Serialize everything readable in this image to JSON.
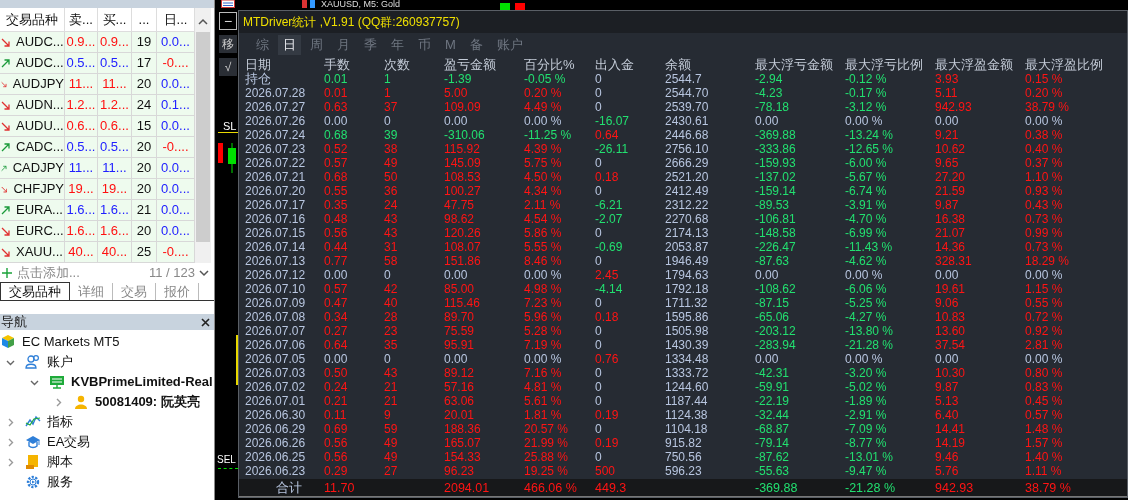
{
  "market_watch": {
    "columns": [
      "交易品种",
      "卖...",
      "买...",
      "...",
      "日..."
    ],
    "rows": [
      {
        "rising": false,
        "daily_down": false,
        "cells": [
          "AUDC...",
          "0.9...",
          "0.9...",
          "19",
          "0.0..."
        ]
      },
      {
        "rising": true,
        "daily_down": true,
        "cells": [
          "AUDC...",
          "0.5...",
          "0.5...",
          "17",
          "-0...."
        ]
      },
      {
        "rising": false,
        "daily_down": false,
        "cells": [
          "AUDJPY",
          "11...",
          "11...",
          "20",
          "0.0..."
        ]
      },
      {
        "rising": false,
        "daily_down": false,
        "cells": [
          "AUDN...",
          "1.2...",
          "1.2...",
          "24",
          "0.1..."
        ]
      },
      {
        "rising": false,
        "daily_down": false,
        "cells": [
          "AUDU...",
          "0.6...",
          "0.6...",
          "15",
          "0.0..."
        ]
      },
      {
        "rising": true,
        "daily_down": true,
        "cells": [
          "CADC...",
          "0.5...",
          "0.5...",
          "20",
          "-0...."
        ]
      },
      {
        "rising": true,
        "daily_down": false,
        "cells": [
          "CADJPY",
          "11...",
          "11...",
          "20",
          "0.0..."
        ]
      },
      {
        "rising": false,
        "daily_down": false,
        "cells": [
          "CHFJPY",
          "19...",
          "19...",
          "20",
          "0.0..."
        ]
      },
      {
        "rising": true,
        "daily_down": false,
        "cells": [
          "EURA...",
          "1.6...",
          "1.6...",
          "21",
          "0.0..."
        ]
      },
      {
        "rising": false,
        "daily_down": false,
        "cells": [
          "EURC...",
          "1.6...",
          "1.6...",
          "20",
          "0.0..."
        ]
      },
      {
        "rising": false,
        "daily_down": true,
        "cells": [
          "XAUU...",
          "40...",
          "40...",
          "25",
          "-0...."
        ]
      }
    ],
    "add_label": "点击添加...",
    "count": "11 / 123",
    "tabs": [
      {
        "label": "交易品种",
        "selected": true
      },
      {
        "label": "详细",
        "selected": false
      },
      {
        "label": "交易",
        "selected": false
      },
      {
        "label": "报价",
        "selected": false
      }
    ]
  },
  "navigator": {
    "title": "导航",
    "items": [
      {
        "label": "EC Markets MT5",
        "kind": "broker",
        "children": [
          {
            "label": "账户",
            "kind": "accounts",
            "expanded": true,
            "children": [
              {
                "label": "KVBPrimeLimited-Real",
                "kind": "server",
                "expanded": true,
                "children": [
                  {
                    "label": "50081409: 阮英亮",
                    "kind": "account",
                    "expanded": false
                  }
                ]
              }
            ]
          },
          {
            "label": "指标",
            "kind": "indicators",
            "expanded": false
          },
          {
            "label": "EA交易",
            "kind": "experts",
            "expanded": false
          },
          {
            "label": "脚本",
            "kind": "scripts",
            "expanded": false
          },
          {
            "label": "服务",
            "kind": "services"
          }
        ]
      }
    ]
  },
  "chart": {
    "title": "XAUUSD, M5: Gold",
    "toolbar": [
      {
        "kind": "minus",
        "label": "−"
      },
      {
        "kind": "text",
        "label": "移"
      },
      {
        "kind": "text",
        "label": "√"
      }
    ],
    "sl_label": "SL",
    "sell_label": "SEL"
  },
  "stats_panel": {
    "title": "MTDriver统计 ,V1.91 (QQ群:260937757)",
    "tabs": [
      {
        "label": "综",
        "selected": false
      },
      {
        "label": "日",
        "selected": true
      },
      {
        "label": "周",
        "selected": false
      },
      {
        "label": "月",
        "selected": false
      },
      {
        "label": "季",
        "selected": false
      },
      {
        "label": "年",
        "selected": false
      },
      {
        "label": "币",
        "selected": false
      },
      {
        "label": "M",
        "selected": false
      },
      {
        "label": "备",
        "selected": false
      },
      {
        "label": "账户",
        "selected": false
      }
    ],
    "columns": [
      "日期",
      "手数",
      "次数",
      "盈亏金额",
      "百分比%",
      "出入金",
      "余额",
      "最大浮亏金额",
      "最大浮亏比例",
      "最大浮盈金额",
      "最大浮盈比例"
    ],
    "rows": [
      {
        "kind": "loss",
        "deposit": false,
        "withdrawal": false,
        "cells": [
          "持仓",
          "0.01",
          "1",
          "-1.39",
          "-0.05 %",
          "0",
          "2544.7",
          "-2.94",
          "-0.12 %",
          "3.93",
          "0.15 %"
        ]
      },
      {
        "kind": "profit",
        "deposit": false,
        "withdrawal": false,
        "cells": [
          "2026.07.28",
          "0.01",
          "1",
          "5.00",
          "0.20 %",
          "0",
          "2544.70",
          "-4.23",
          "-0.17 %",
          "5.11",
          "0.20 %"
        ]
      },
      {
        "kind": "profit",
        "deposit": false,
        "withdrawal": false,
        "cells": [
          "2026.07.27",
          "0.63",
          "37",
          "109.09",
          "4.49 %",
          "0",
          "2539.70",
          "-78.18",
          "-3.12 %",
          "942.93",
          "38.79 %"
        ]
      },
      {
        "kind": "flat",
        "deposit": false,
        "withdrawal": true,
        "cells": [
          "2026.07.26",
          "0.00",
          "0",
          "0.00",
          "0.00 %",
          "-16.07",
          "2430.61",
          "0.00",
          "0.00 %",
          "0.00",
          "0.00 %"
        ]
      },
      {
        "kind": "loss",
        "deposit": true,
        "withdrawal": false,
        "cells": [
          "2026.07.24",
          "0.68",
          "39",
          "-310.06",
          "-11.25 %",
          "0.64",
          "2446.68",
          "-369.88",
          "-13.24 %",
          "9.21",
          "0.38 %"
        ]
      },
      {
        "kind": "profit",
        "deposit": false,
        "withdrawal": true,
        "cells": [
          "2026.07.23",
          "0.52",
          "38",
          "115.92",
          "4.39 %",
          "-26.11",
          "2756.10",
          "-333.86",
          "-12.65 %",
          "10.62",
          "0.40 %"
        ]
      },
      {
        "kind": "profit",
        "deposit": false,
        "withdrawal": false,
        "cells": [
          "2026.07.22",
          "0.57",
          "49",
          "145.09",
          "5.75 %",
          "0",
          "2666.29",
          "-159.93",
          "-6.00 %",
          "9.65",
          "0.37 %"
        ]
      },
      {
        "kind": "profit",
        "deposit": true,
        "withdrawal": false,
        "cells": [
          "2026.07.21",
          "0.68",
          "50",
          "108.53",
          "4.50 %",
          "0.18",
          "2521.20",
          "-137.02",
          "-5.67 %",
          "27.20",
          "1.10 %"
        ]
      },
      {
        "kind": "profit",
        "deposit": false,
        "withdrawal": false,
        "cells": [
          "2026.07.20",
          "0.55",
          "36",
          "100.27",
          "4.34 %",
          "0",
          "2412.49",
          "-159.14",
          "-6.74 %",
          "21.59",
          "0.93 %"
        ]
      },
      {
        "kind": "profit",
        "deposit": false,
        "withdrawal": true,
        "cells": [
          "2026.07.17",
          "0.35",
          "24",
          "47.75",
          "2.11 %",
          "-6.21",
          "2312.22",
          "-89.53",
          "-3.91 %",
          "9.87",
          "0.43 %"
        ]
      },
      {
        "kind": "profit",
        "deposit": false,
        "withdrawal": true,
        "cells": [
          "2026.07.16",
          "0.48",
          "43",
          "98.62",
          "4.54 %",
          "-2.07",
          "2270.68",
          "-106.81",
          "-4.70 %",
          "16.38",
          "0.73 %"
        ]
      },
      {
        "kind": "profit",
        "deposit": false,
        "withdrawal": false,
        "cells": [
          "2026.07.15",
          "0.56",
          "43",
          "120.26",
          "5.86 %",
          "0",
          "2174.13",
          "-148.58",
          "-6.99 %",
          "21.07",
          "0.99 %"
        ]
      },
      {
        "kind": "profit",
        "deposit": false,
        "withdrawal": true,
        "cells": [
          "2026.07.14",
          "0.44",
          "31",
          "108.07",
          "5.55 %",
          "-0.69",
          "2053.87",
          "-226.47",
          "-11.43 %",
          "14.36",
          "0.73 %"
        ]
      },
      {
        "kind": "profit",
        "deposit": false,
        "withdrawal": false,
        "cells": [
          "2026.07.13",
          "0.77",
          "58",
          "151.86",
          "8.46 %",
          "0",
          "1946.49",
          "-87.63",
          "-4.62 %",
          "328.31",
          "18.29 %"
        ]
      },
      {
        "kind": "flat",
        "deposit": true,
        "withdrawal": false,
        "cells": [
          "2026.07.12",
          "0.00",
          "0",
          "0.00",
          "0.00 %",
          "2.45",
          "1794.63",
          "0.00",
          "0.00 %",
          "0.00",
          "0.00 %"
        ]
      },
      {
        "kind": "profit",
        "deposit": false,
        "withdrawal": true,
        "cells": [
          "2026.07.10",
          "0.57",
          "42",
          "85.00",
          "4.98 %",
          "-4.14",
          "1792.18",
          "-108.62",
          "-6.06 %",
          "19.61",
          "1.15 %"
        ]
      },
      {
        "kind": "profit",
        "deposit": false,
        "withdrawal": false,
        "cells": [
          "2026.07.09",
          "0.47",
          "40",
          "115.46",
          "7.23 %",
          "0",
          "1711.32",
          "-87.15",
          "-5.25 %",
          "9.06",
          "0.55 %"
        ]
      },
      {
        "kind": "profit",
        "deposit": true,
        "withdrawal": false,
        "cells": [
          "2026.07.08",
          "0.34",
          "28",
          "89.70",
          "5.96 %",
          "0.18",
          "1595.86",
          "-65.06",
          "-4.27 %",
          "10.83",
          "0.72 %"
        ]
      },
      {
        "kind": "profit",
        "deposit": false,
        "withdrawal": false,
        "cells": [
          "2026.07.07",
          "0.27",
          "23",
          "75.59",
          "5.28 %",
          "0",
          "1505.98",
          "-203.12",
          "-13.80 %",
          "13.60",
          "0.92 %"
        ]
      },
      {
        "kind": "profit",
        "deposit": false,
        "withdrawal": false,
        "cells": [
          "2026.07.06",
          "0.64",
          "35",
          "95.91",
          "7.19 %",
          "0",
          "1430.39",
          "-283.94",
          "-21.28 %",
          "37.54",
          "2.81 %"
        ]
      },
      {
        "kind": "flat",
        "deposit": true,
        "withdrawal": false,
        "cells": [
          "2026.07.05",
          "0.00",
          "0",
          "0.00",
          "0.00 %",
          "0.76",
          "1334.48",
          "0.00",
          "0.00 %",
          "0.00",
          "0.00 %"
        ]
      },
      {
        "kind": "profit",
        "deposit": false,
        "withdrawal": false,
        "cells": [
          "2026.07.03",
          "0.50",
          "43",
          "89.12",
          "7.16 %",
          "0",
          "1333.72",
          "-42.31",
          "-3.20 %",
          "10.30",
          "0.80 %"
        ]
      },
      {
        "kind": "profit",
        "deposit": false,
        "withdrawal": false,
        "cells": [
          "2026.07.02",
          "0.24",
          "21",
          "57.16",
          "4.81 %",
          "0",
          "1244.60",
          "-59.91",
          "-5.02 %",
          "9.87",
          "0.83 %"
        ]
      },
      {
        "kind": "profit",
        "deposit": false,
        "withdrawal": false,
        "cells": [
          "2026.07.01",
          "0.21",
          "21",
          "63.06",
          "5.61 %",
          "0",
          "1187.44",
          "-22.19",
          "-1.89 %",
          "5.13",
          "0.45 %"
        ]
      },
      {
        "kind": "profit",
        "deposit": true,
        "withdrawal": false,
        "cells": [
          "2026.06.30",
          "0.11",
          "9",
          "20.01",
          "1.81 %",
          "0.19",
          "1124.38",
          "-32.44",
          "-2.91 %",
          "6.40",
          "0.57 %"
        ]
      },
      {
        "kind": "profit",
        "deposit": false,
        "withdrawal": false,
        "cells": [
          "2026.06.29",
          "0.69",
          "59",
          "188.36",
          "20.57 %",
          "0",
          "1104.18",
          "-68.87",
          "-7.09 %",
          "14.41",
          "1.48 %"
        ]
      },
      {
        "kind": "profit",
        "deposit": true,
        "withdrawal": false,
        "cells": [
          "2026.06.26",
          "0.56",
          "49",
          "165.07",
          "21.99 %",
          "0.19",
          "915.82",
          "-79.14",
          "-8.77 %",
          "14.19",
          "1.57 %"
        ]
      },
      {
        "kind": "profit",
        "deposit": false,
        "withdrawal": false,
        "cells": [
          "2026.06.25",
          "0.56",
          "49",
          "154.33",
          "25.88 %",
          "0",
          "750.56",
          "-87.62",
          "-13.01 %",
          "9.46",
          "1.40 %"
        ]
      },
      {
        "kind": "profit",
        "deposit": true,
        "withdrawal": false,
        "cells": [
          "2026.06.23",
          "0.29",
          "27",
          "96.23",
          "19.25 %",
          "500",
          "596.23",
          "-55.63",
          "-9.47 %",
          "5.76",
          "1.11 %"
        ]
      }
    ],
    "totals": {
      "label": "合计",
      "lots": "11.70",
      "profit": "2094.01",
      "percent": "466.06 %",
      "transfer": "449.3",
      "max_float_loss": "-369.88",
      "max_float_loss_pct": "-21.28 %",
      "max_float_profit": "942.93",
      "max_float_profit_pct": "38.79 %"
    }
  }
}
